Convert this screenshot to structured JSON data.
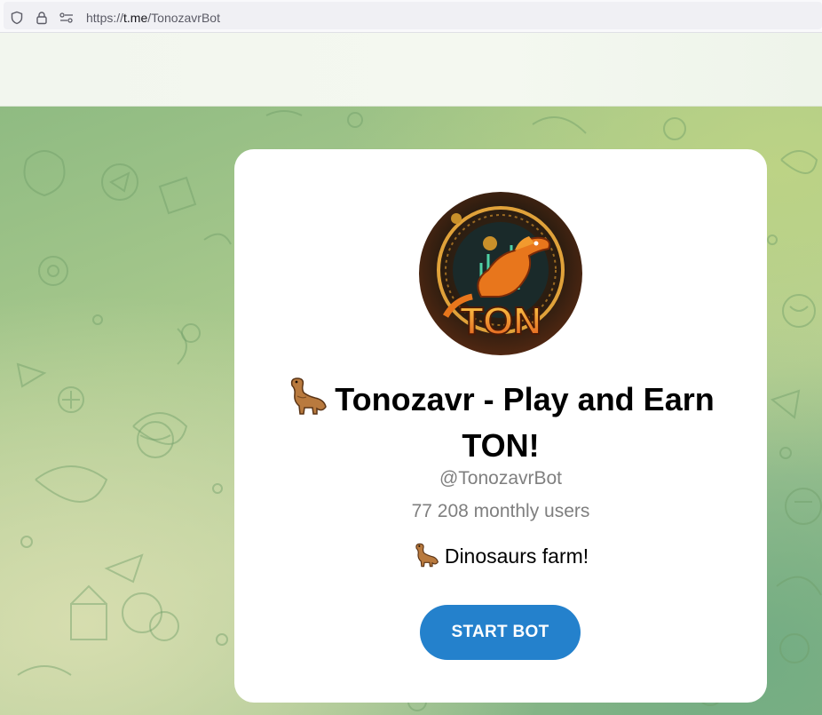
{
  "browser": {
    "url_prefix": "https://",
    "url_domain": "t.me",
    "url_path": "/TonozavrBot",
    "icons": [
      "shield-icon",
      "lock-icon",
      "permissions-icon"
    ]
  },
  "bot": {
    "avatar_text": "TON",
    "title": "Tonozavr - Play and Earn TON!",
    "title_emoji": "sauropod-dino-emoji",
    "username": "@TonozavrBot",
    "monthly_users": "77 208 monthly users",
    "description": "Dinosaurs farm!",
    "description_emoji": "sauropod-dino-emoji",
    "start_button": "START BOT"
  },
  "colors": {
    "button": "#2481cc",
    "background": "#a9c98d",
    "card": "#ffffff"
  }
}
